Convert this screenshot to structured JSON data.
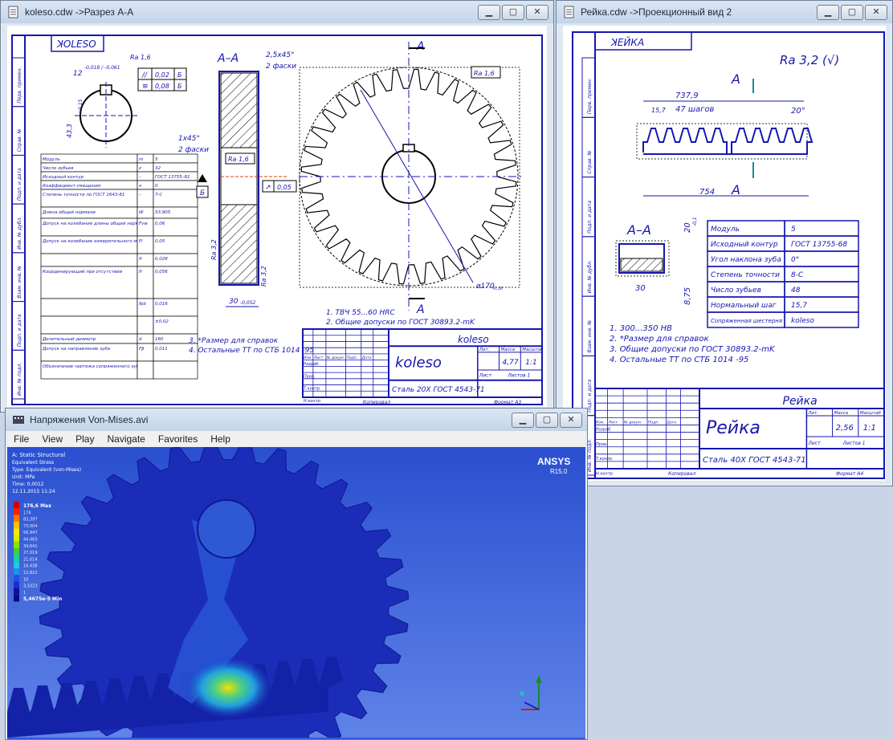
{
  "win1": {
    "title": "koleso.cdw ->Разрез А-А",
    "section_label": "А–А",
    "chamfer_top": "2,5x45°",
    "chamfer_top_note": "2 фаски",
    "chamfer_left": "1x45°",
    "chamfer_left_note": "2 фаски",
    "ra16": "Ra 1,6",
    "ra32": "Ra 3,2",
    "ra16_gear": "Ra 1,6",
    "section_letter": "А",
    "width_dim": "30",
    "width_tol": "-0,052",
    "hub_dim": "12",
    "hub_tol": "-0,018 / -0,061",
    "hub_depth": "43,3",
    "hub_depth_tol": "+0,15",
    "tol1": "0,02",
    "tol2": "0,08",
    "tol_letter": "Б",
    "datum": "Б",
    "runout": "0,05",
    "dia_out": "ø170",
    "dia_out_tol": "-0,16",
    "mark": "ꓘОLESO",
    "notes": [
      "1. ТВЧ 55...60 HRC",
      "2. Общие допуски по ГОСТ 30893.2-mK"
    ],
    "notes2": [
      "3. *Размер для справок",
      "4. Остальные ТТ по СТБ 1014 -95"
    ],
    "param_table": [
      [
        "Модуль",
        "m",
        "5"
      ],
      [
        "Число зубьев",
        "z",
        "32"
      ],
      [
        "Исходный контур",
        "–",
        "ГОСТ 13755–81"
      ],
      [
        "Коэффициент смещения",
        "x",
        "0"
      ],
      [
        "Степень точности по ГОСТ 1643-81",
        "–",
        "7-С"
      ],
      [
        "Длина общей нормали",
        "W",
        "53,905"
      ],
      [
        "Допуск на колебание длины общей нормали",
        "Fvw",
        "0,06"
      ],
      [
        "Допуск на колебание измерительного межосевого расстояния",
        "Fi",
        "0,05"
      ],
      [
        "",
        "fi",
        "0,028"
      ],
      [
        "Координирующий при отсутствии",
        "fr",
        "0,056"
      ],
      [
        "",
        "fpb",
        "0,016"
      ],
      [
        "",
        "",
        "±0,02"
      ],
      [
        "Делительный диаметр",
        "d",
        "160"
      ],
      [
        "Допуск на направление зуба",
        "Fβ",
        "0,011"
      ],
      [
        "Обозначение чертежа сопряженного зубчатого колеса",
        "",
        ""
      ]
    ],
    "stamp": {
      "name": "koleso",
      "name_big": "koleso",
      "material": "Сталь 20Х ГОСТ 4543-71",
      "hdr": [
        "Лит.",
        "Масса",
        "Масштаб"
      ],
      "mass": "4,77",
      "scale": "1:1",
      "sheet": "Лист",
      "sheets": "Листов 1",
      "copied": "Копировал",
      "format": "Формат  А3",
      "roles": [
        "Изм.",
        "Лист",
        "№ докум.",
        "Подп.",
        "Дата",
        "Разраб.",
        "Пров.",
        "Т.контр.",
        "Н.контр.",
        "Утв."
      ]
    },
    "side_labels": [
      "Перв. примен.",
      "Справ. №",
      "Подп. и дата",
      "Инв. № дубл.",
      "Взам. инв. №",
      "Подп. и дата",
      "Инв. № подл."
    ]
  },
  "win2": {
    "title": "Рейка.cdw ->Проекционный вид 2",
    "ra_mark": "Ra 3,2 (√)",
    "section": "А",
    "dim_total": "737,9",
    "dim_pitch": "47 шагов",
    "dim_angle": "20°",
    "dim_first": "15,7",
    "dim_length": "754",
    "sec_label": "А–А",
    "sec_w": "30",
    "sec_h": "20",
    "sec_h_tol": "-0,1",
    "sec_dim": "8,75",
    "mark": "ꓘЕЙКА",
    "params": [
      [
        "Модуль",
        "5"
      ],
      [
        "Исходный контур",
        "ГОСТ 13755-68"
      ],
      [
        "Угол наклона зуба",
        "0°"
      ],
      [
        "Степень точности",
        "8-С"
      ],
      [
        "Число зубьев",
        "48"
      ],
      [
        "Нормальный шаг",
        "15,7"
      ],
      [
        "Сопряженная шестерня",
        "koleso"
      ]
    ],
    "notes": [
      "1. 300...350 НВ",
      "2. *Размер для справок",
      "3. Общие допуски по ГОСТ 30893.2-mK",
      "4. Остальные ТТ по СТБ 1014 -95"
    ],
    "stamp": {
      "name": "Рейка",
      "name_big": "Рейка",
      "material": "Сталь 40Х ГОСТ 4543-71",
      "hdr": [
        "Лит.",
        "Масса",
        "Масштаб"
      ],
      "mass": "2,56",
      "scale": "1:1",
      "sheet": "Лист",
      "sheets": "Листов  1",
      "copied": "Копировал",
      "format": "Формат  А4",
      "roles": [
        "Изм.",
        "Лист",
        "№ докум.",
        "Подп.",
        "Дата",
        "Разраб.",
        "Пров.",
        "Т.контр.",
        "Н.контр.",
        "Утв."
      ]
    },
    "side_labels": [
      "Перв. примен.",
      "Справ. №",
      "Подп. и дата",
      "Инв. № дубл.",
      "Взам. инв. №",
      "Подп. и дата",
      "Инв. № подл."
    ]
  },
  "win3": {
    "title": "Напряжения Von-Mises.avi",
    "menu": [
      "File",
      "View",
      "Play",
      "Navigate",
      "Favorites",
      "Help"
    ],
    "brand": "ANSYS",
    "version": "R15.0",
    "info": [
      "A: Static Structural",
      "Equivalent Stress",
      "Type: Equivalent (von-Mises)",
      "Unit: MPa",
      "Time: 0,0012",
      "12.11.2015 11:24"
    ],
    "legend": [
      "176,6 Max",
      "174",
      "83,397",
      "73,004",
      "56,947",
      "44,463",
      "34,641",
      "27,019",
      "21,014",
      "16,438",
      "12,822",
      "10",
      "3,1023",
      "1",
      "5,4675e-5 Min"
    ],
    "legend_colors": [
      "#d40000",
      "#ff2000",
      "#ff7a00",
      "#ffc000",
      "#ffe800",
      "#d8f000",
      "#90e000",
      "#40d040",
      "#20d0a0",
      "#20c8e0",
      "#2090f0",
      "#2050e8",
      "#1830c8",
      "#1010a0",
      "#0a0a80"
    ]
  },
  "colors": {
    "cad_blue": "#1616b0",
    "deep_blue": "#1a26b0",
    "sky": "#2f58d6"
  }
}
